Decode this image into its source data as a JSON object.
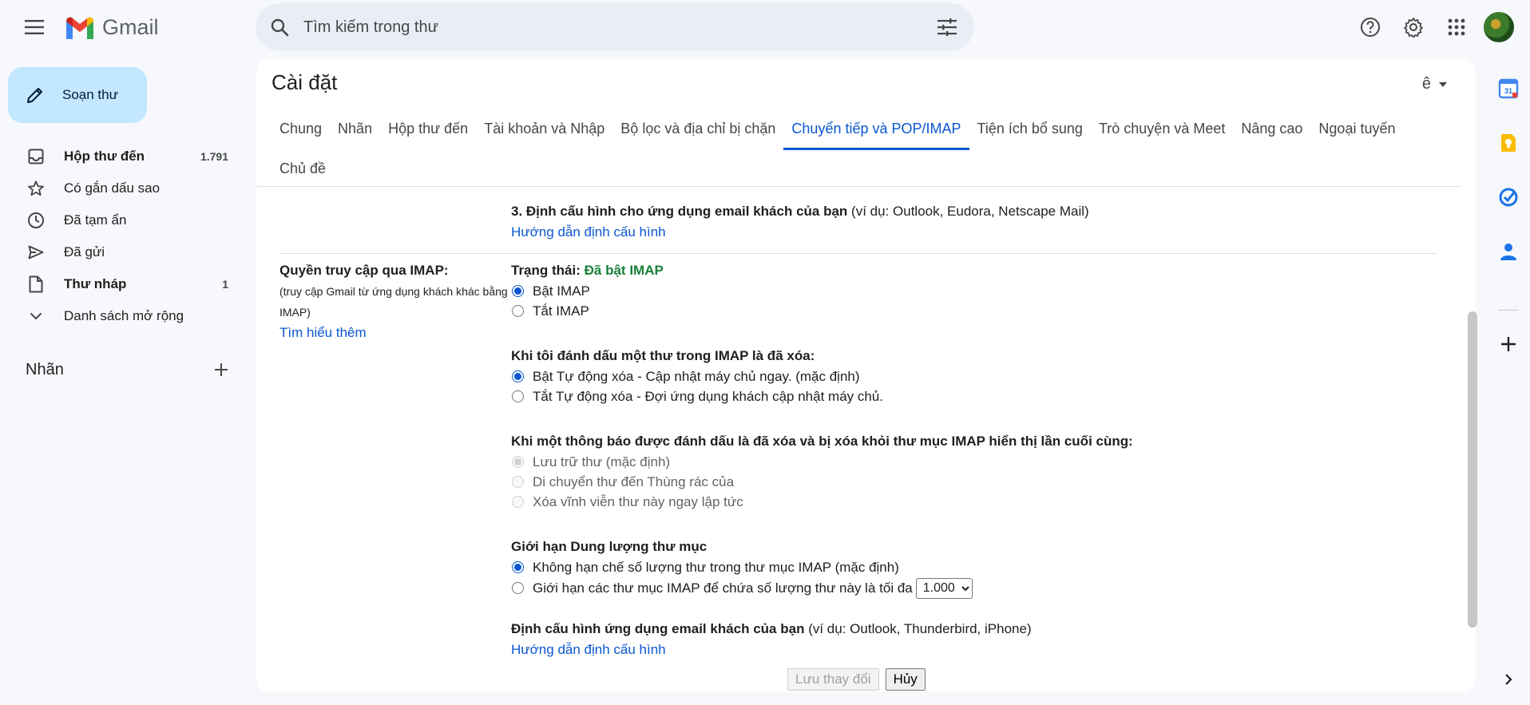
{
  "app": {
    "name": "Gmail"
  },
  "search": {
    "placeholder": "Tìm kiếm trong thư"
  },
  "compose": {
    "label": "Soạn thư"
  },
  "sidebar": {
    "items": [
      {
        "label": "Hộp thư đến",
        "count": "1.791",
        "icon": "inbox-icon",
        "bold": true
      },
      {
        "label": "Có gắn dấu sao",
        "count": "",
        "icon": "star-icon",
        "bold": false
      },
      {
        "label": "Đã tạm ẩn",
        "count": "",
        "icon": "clock-icon",
        "bold": false
      },
      {
        "label": "Đã gửi",
        "count": "",
        "icon": "send-icon",
        "bold": false
      },
      {
        "label": "Thư nháp",
        "count": "1",
        "icon": "draft-icon",
        "bold": true
      },
      {
        "label": "Danh sách mở rộng",
        "count": "",
        "icon": "chevron-down-icon",
        "bold": false
      }
    ],
    "labels_heading": "Nhãn"
  },
  "settings": {
    "title": "Cài đặt",
    "lang_glyph": "ê",
    "tabs": [
      {
        "label": "Chung",
        "active": false
      },
      {
        "label": "Nhãn",
        "active": false
      },
      {
        "label": "Hộp thư đến",
        "active": false
      },
      {
        "label": "Tài khoản và Nhập",
        "active": false
      },
      {
        "label": "Bộ lọc và địa chỉ bị chặn",
        "active": false
      },
      {
        "label": "Chuyển tiếp và POP/IMAP",
        "active": true
      },
      {
        "label": "Tiện ích bổ sung",
        "active": false
      },
      {
        "label": "Trò chuyện và Meet",
        "active": false
      },
      {
        "label": "Nâng cao",
        "active": false
      },
      {
        "label": "Ngoại tuyến",
        "active": false
      },
      {
        "label": "Chủ đề",
        "active": false
      }
    ],
    "pop_config": {
      "heading": "3. Định cấu hình cho ứng dụng email khách của bạn",
      "example": "(ví dụ: Outlook, Eudora, Netscape Mail)",
      "link": "Hướng dẫn định cấu hình"
    },
    "imap": {
      "label": "Quyền truy cập qua IMAP:",
      "sub": "(truy cập Gmail từ ứng dụng khách khác bằng IMAP)",
      "learn_more": "Tìm hiểu thêm",
      "status_prefix": "Trạng thái:",
      "status_value": "Đã bật IMAP",
      "enable": "Bật IMAP",
      "disable": "Tắt IMAP",
      "expunge_title": "Khi tôi đánh dấu một thư trong IMAP là đã xóa:",
      "expunge_on": "Bật Tự động xóa - Cập nhật máy chủ ngay. (mặc định)",
      "expunge_off": "Tắt Tự động xóa - Đợi ứng dụng khách cập nhật máy chủ.",
      "deleted_title": "Khi một thông báo được đánh dấu là đã xóa và bị xóa khỏi thư mục IMAP hiển thị lần cuối cùng:",
      "deleted_archive": "Lưu trữ thư (mặc định)",
      "deleted_trash": "Di chuyển thư đến Thùng rác của",
      "deleted_forever": "Xóa vĩnh viễn thư này ngay lập tức",
      "folder_title": "Giới hạn Dung lượng thư mục",
      "folder_unlimited": "Không hạn chế số lượng thư trong thư mục IMAP (mặc định)",
      "folder_limit": "Giới hạn các thư mục IMAP để chứa số lượng thư này là tối đa",
      "folder_limit_value": "1.000",
      "client_heading": "Định cấu hình ứng dụng email khách của bạn",
      "client_example": "(ví dụ: Outlook, Thunderbird, iPhone)",
      "client_link": "Hướng dẫn định cấu hình"
    },
    "save_label": "Lưu thay đổi",
    "cancel_label": "Hủy"
  },
  "side_panel": {
    "calendar_day": "31"
  },
  "colors": {
    "accent": "#0b57d0",
    "compose_bg": "#c2e7ff",
    "status_green": "#188038"
  }
}
